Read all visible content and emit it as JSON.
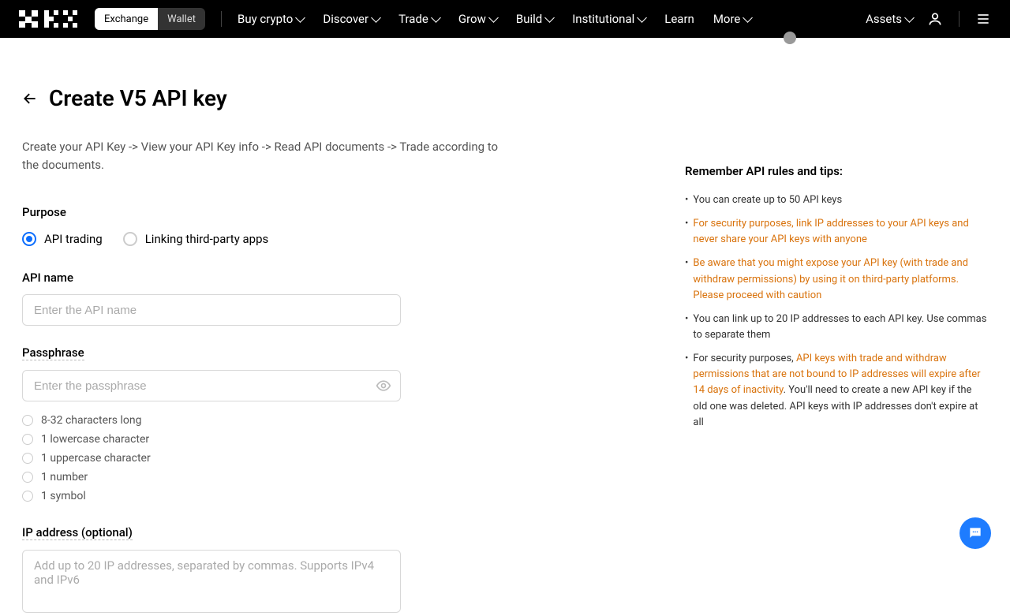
{
  "header": {
    "segmented": {
      "exchange": "Exchange",
      "wallet": "Wallet"
    },
    "nav": [
      "Buy crypto",
      "Discover",
      "Trade",
      "Grow",
      "Build",
      "Institutional",
      "Learn",
      "More"
    ],
    "nav_has_chevron": [
      true,
      true,
      true,
      true,
      true,
      true,
      false,
      true
    ],
    "assets": "Assets"
  },
  "page": {
    "title": "Create V5 API key",
    "subtitle": "Create your API Key -> View your API Key info -> Read API documents -> Trade according to the documents."
  },
  "purpose": {
    "label": "Purpose",
    "option1": "API trading",
    "option2": "Linking third-party apps"
  },
  "api_name": {
    "label": "API name",
    "placeholder": "Enter the API name"
  },
  "passphrase": {
    "label": "Passphrase",
    "placeholder": "Enter the passphrase",
    "rules": [
      "8-32 characters long",
      "1 lowercase character",
      "1 uppercase character",
      "1 number",
      "1 symbol"
    ]
  },
  "ip": {
    "label": "IP address (optional)",
    "placeholder": "Add up to 20 IP addresses, separated by commas. Supports IPv4 and IPv6"
  },
  "tips": {
    "title": "Remember API rules and tips:",
    "items": [
      {
        "pre": "You can create up to 50 API keys",
        "hl": "",
        "post": ""
      },
      {
        "pre": "",
        "hl": "For security purposes, link IP addresses to your API keys and never share your API keys with anyone",
        "post": ""
      },
      {
        "pre": "",
        "hl": "Be aware that you might expose your API key (with trade and withdraw permissions) by using it on third-party platforms. Please proceed with caution",
        "post": ""
      },
      {
        "pre": "You can link up to 20 IP addresses to each API key. Use commas to separate them",
        "hl": "",
        "post": ""
      },
      {
        "pre": "For security purposes, ",
        "hl": "API keys with trade and withdraw permissions that are not bound to IP addresses will expire after 14 days of inactivity",
        "post": ". You'll need to create a new API key if the old one was deleted. API keys with IP addresses don't expire at all"
      }
    ]
  }
}
